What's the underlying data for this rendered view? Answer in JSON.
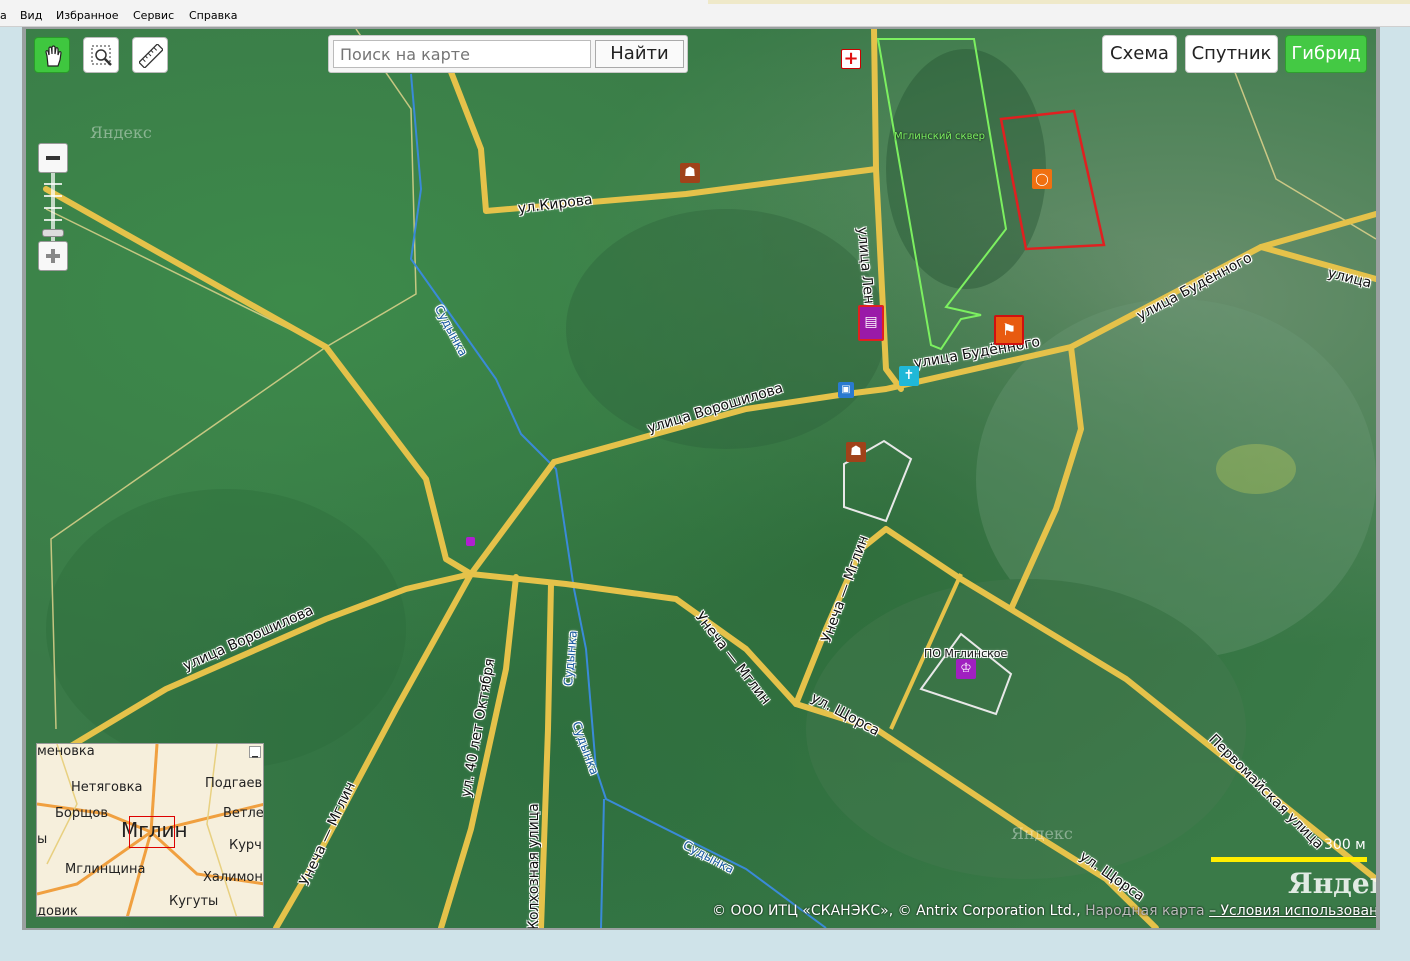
{
  "menu": {
    "items": [
      "а",
      "Вид",
      "Избранное",
      "Сервис",
      "Справка"
    ]
  },
  "toolbar": {
    "search_placeholder": "Поиск на карте",
    "search_button": "Найти",
    "map_types": [
      "Схема",
      "Спутник",
      "Гибрид"
    ],
    "active_map_type": "Гибрид"
  },
  "map": {
    "watermarks": [
      "Яндекс",
      "Яндекс"
    ],
    "streets": {
      "kirova": "ул.Кирова",
      "lenina": "улица Ленина",
      "budennogo_1": "улица Будённого",
      "budennogo_2": "улица Будённого",
      "ulitsa": "улица",
      "voroshilova_1": "улица Ворошилова",
      "voroshilova_2": "улица Ворошилова",
      "unecha_mglin_1": "Унеча — Мглин",
      "unecha_mglin_2": "Унеча — Мглин",
      "unecha_mglin_3": "Унеча — Мглин",
      "shchorsa_1": "ул. Щорса",
      "shchorsa_2": "ул. Щорса",
      "pervomayskaya": "Первомайская улица",
      "oktyabrya": "ул. 40 лет Октября",
      "kolkhoznaya": "Колхозная улица"
    },
    "rivers": [
      "Судынка",
      "Судынка",
      "Судынка",
      "Судынка"
    ],
    "places": {
      "skver": "Мглинский сквер",
      "po": "ПО Мглинское"
    },
    "pois": [
      {
        "name": "hospital",
        "color": "#ffffff"
      },
      {
        "name": "school",
        "color": "#a0421a"
      },
      {
        "name": "school",
        "color": "#a0421a"
      },
      {
        "name": "shop",
        "color": "#a020c0"
      },
      {
        "name": "sport",
        "color": "#e04010"
      },
      {
        "name": "stadium",
        "color": "#e06010"
      },
      {
        "name": "bus",
        "color": "#2a7ad0"
      },
      {
        "name": "monument",
        "color": "#20b0d0"
      },
      {
        "name": "company",
        "color": "#a020c0"
      }
    ]
  },
  "minimap": {
    "labels": [
      "меновка",
      "Нетяговка",
      "Подгаев",
      "Борщов",
      "Ветле",
      "Мглин",
      "Курч",
      "ы",
      "Мглинщина",
      "Халимон",
      "Кугуты",
      "довик"
    ]
  },
  "scale": {
    "text": "300 м"
  },
  "logo": "Яндекс",
  "copyright": {
    "main": "© ООО ИТЦ «СКАНЭКС», © Antrix Corporation Ltd.,",
    "narodnaya": "Народная карта",
    "terms": "– Условия использования"
  }
}
